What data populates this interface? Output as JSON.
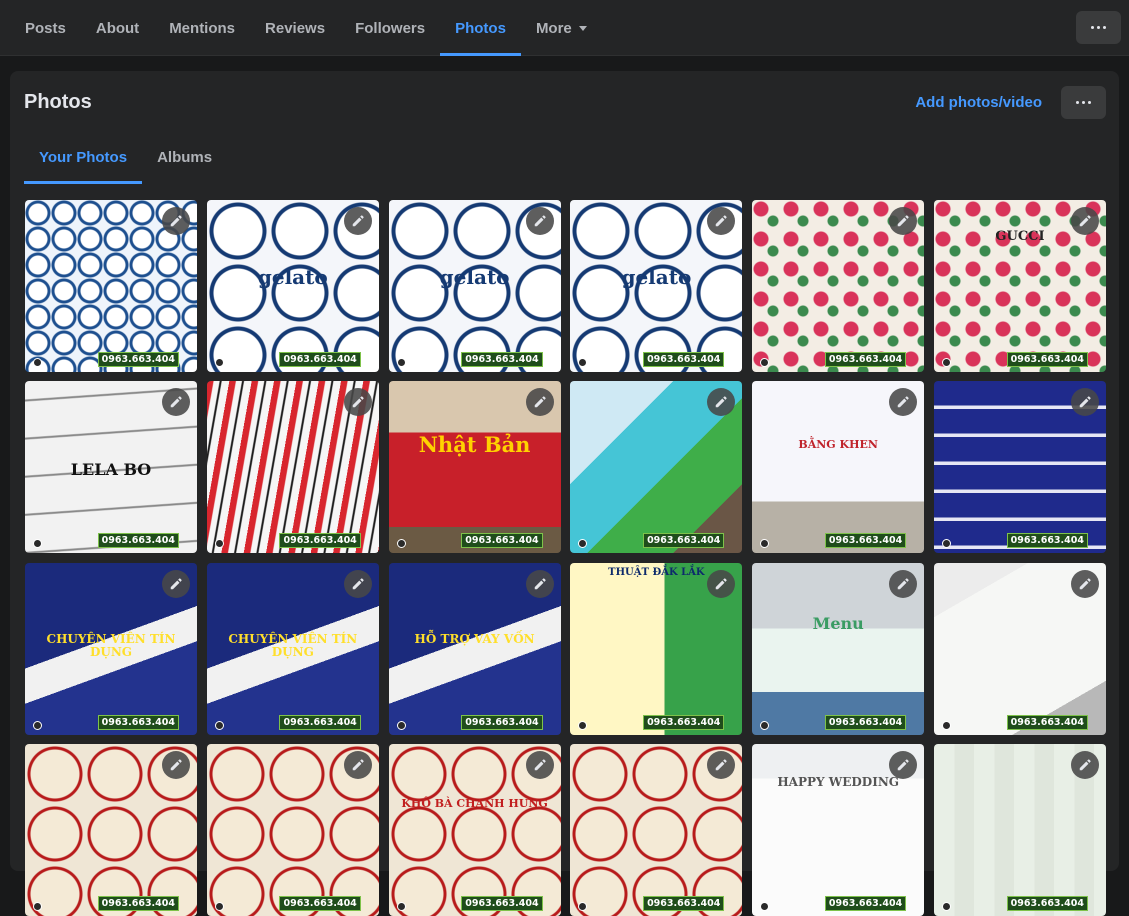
{
  "nav": {
    "tabs": [
      {
        "label": "Posts",
        "active": false
      },
      {
        "label": "About",
        "active": false
      },
      {
        "label": "Mentions",
        "active": false
      },
      {
        "label": "Reviews",
        "active": false
      },
      {
        "label": "Followers",
        "active": false
      },
      {
        "label": "Photos",
        "active": true
      },
      {
        "label": "More",
        "active": false
      }
    ],
    "more_icon": "caret-down-icon",
    "menu_icon": "more-horizontal-icon"
  },
  "photos": {
    "title": "Photos",
    "add_label": "Add photos/video",
    "menu_icon": "more-horizontal-icon",
    "tabs": [
      {
        "label": "Your Photos",
        "active": true
      },
      {
        "label": "Albums",
        "active": false
      }
    ],
    "edit_icon": "pencil-icon",
    "phone_badge": "0963.663.404",
    "accent_color": "#4599ff",
    "items": [
      {
        "kind": "stickers",
        "label": ""
      },
      {
        "kind": "gelato",
        "label": "gelato"
      },
      {
        "kind": "gelato",
        "label": "gelato"
      },
      {
        "kind": "gelato",
        "label": "gelato"
      },
      {
        "kind": "floral",
        "label": ""
      },
      {
        "kind": "floral",
        "label": "GUCCI"
      },
      {
        "kind": "labels",
        "label": "LELA BO"
      },
      {
        "kind": "barcode",
        "label": ""
      },
      {
        "kind": "bag",
        "label": "Nhật Bản"
      },
      {
        "kind": "flyers",
        "label": ""
      },
      {
        "kind": "certificate",
        "label": "BẰNG KHEN"
      },
      {
        "kind": "bluecards",
        "label": ""
      },
      {
        "kind": "loan",
        "label": "CHUYÊN VIÊN TÍN DỤNG"
      },
      {
        "kind": "loan",
        "label": "CHUYÊN VIÊN TÍN DỤNG"
      },
      {
        "kind": "loan",
        "label": "HỖ TRỢ VAY VỐN"
      },
      {
        "kind": "pricelist",
        "label": "THUẬT ĐẮK LẮK"
      },
      {
        "kind": "menu",
        "label": "Menu"
      },
      {
        "kind": "greencards",
        "label": ""
      },
      {
        "kind": "roundlabels",
        "label": ""
      },
      {
        "kind": "roundlabels",
        "label": ""
      },
      {
        "kind": "roundlabels",
        "label": "KHÔ BÀ CHANH HƯNG"
      },
      {
        "kind": "roundlabels",
        "label": ""
      },
      {
        "kind": "wedding",
        "label": "HAPPY WEDDING"
      },
      {
        "kind": "bottles",
        "label": ""
      }
    ]
  }
}
